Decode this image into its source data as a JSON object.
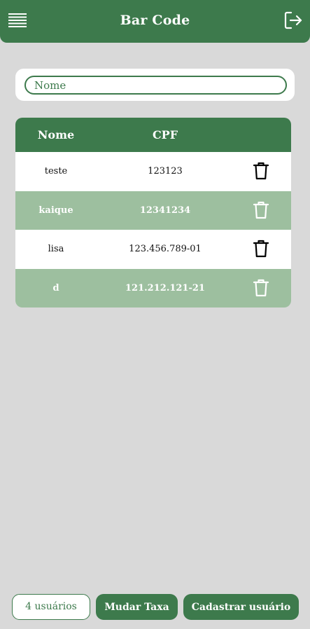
{
  "header": {
    "title": "Bar Code",
    "menu_icon": "hamburger-menu-icon",
    "logout_icon": "logout-icon"
  },
  "search": {
    "placeholder": "Nome",
    "value": ""
  },
  "table": {
    "columns": {
      "nome": "Nome",
      "cpf": "CPF"
    },
    "rows": [
      {
        "nome": "teste",
        "cpf": "123123"
      },
      {
        "nome": "kaique",
        "cpf": "12341234"
      },
      {
        "nome": "lisa",
        "cpf": "123.456.789-01"
      },
      {
        "nome": "d",
        "cpf": "121.212.121-21"
      }
    ],
    "delete_icon": "trash-icon"
  },
  "footer": {
    "user_count": "4 usuários",
    "change_rate_label": "Mudar Taxa",
    "register_user_label": "Cadastrar usuário"
  },
  "colors": {
    "primary": "#3d7a4c",
    "row_alt": "#9dbf9f",
    "background": "#d9d9d9"
  }
}
